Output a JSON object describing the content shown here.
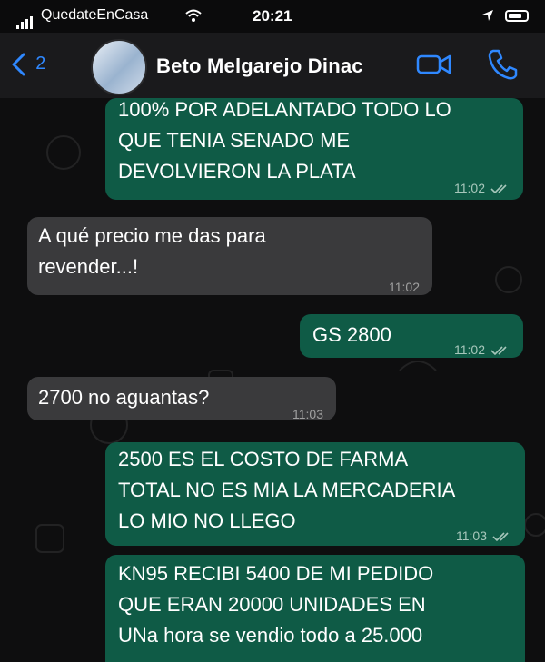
{
  "status_bar": {
    "carrier": "QuedateEnCasa",
    "time": "20:21"
  },
  "header": {
    "back_count": "2",
    "contact_name": "Beto Melgarejo Dinac"
  },
  "messages": [
    {
      "direction": "out",
      "lines": [
        "100% POR ADELANTADO TODO LO",
        "QUE TENIA SENADO ME",
        "DEVOLVIERON LA PLATA"
      ],
      "time": "11:02"
    },
    {
      "direction": "in",
      "lines": [
        "A qué precio me das para",
        "revender...!"
      ],
      "time": "11:02"
    },
    {
      "direction": "out",
      "lines": [
        "GS 2800"
      ],
      "time": "11:02"
    },
    {
      "direction": "in",
      "lines": [
        "2700 no aguantas?"
      ],
      "time": "11:03"
    },
    {
      "direction": "out",
      "lines": [
        "2500 ES EL COSTO DE FARMA",
        "TOTAL NO ES MIA LA MERCADERIA",
        "LO MIO NO LLEGO"
      ],
      "time": "11:03"
    },
    {
      "direction": "out",
      "lines": [
        "KN95 RECIBI 5400 DE MI PEDIDO",
        "QUE ERAN 20000 UNIDADES EN",
        "UNa hora se vendio todo a 25.000"
      ],
      "time": ""
    }
  ],
  "colors": {
    "outgoing_bubble": "#0f5b46",
    "incoming_bubble": "#3a3a3c",
    "accent_blue": "#2f88ff"
  }
}
